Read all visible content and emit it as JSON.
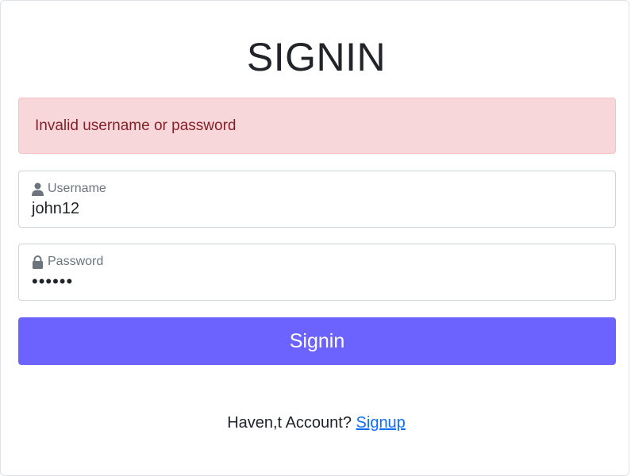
{
  "title": "SIGNIN",
  "alert": {
    "message": "Invalid username or password",
    "background": "#f8d7da",
    "text_color": "#842029"
  },
  "form": {
    "username": {
      "label": "Username",
      "value": "john12",
      "icon": "user-icon"
    },
    "password": {
      "label": "Password",
      "value": "••••••",
      "icon": "lock-icon"
    },
    "submit_label": "Signin",
    "submit_color": "#6c63ff"
  },
  "footer": {
    "prompt": "Haven,t Account?",
    "link_label": "Signup",
    "link_color": "#0d6efd"
  }
}
